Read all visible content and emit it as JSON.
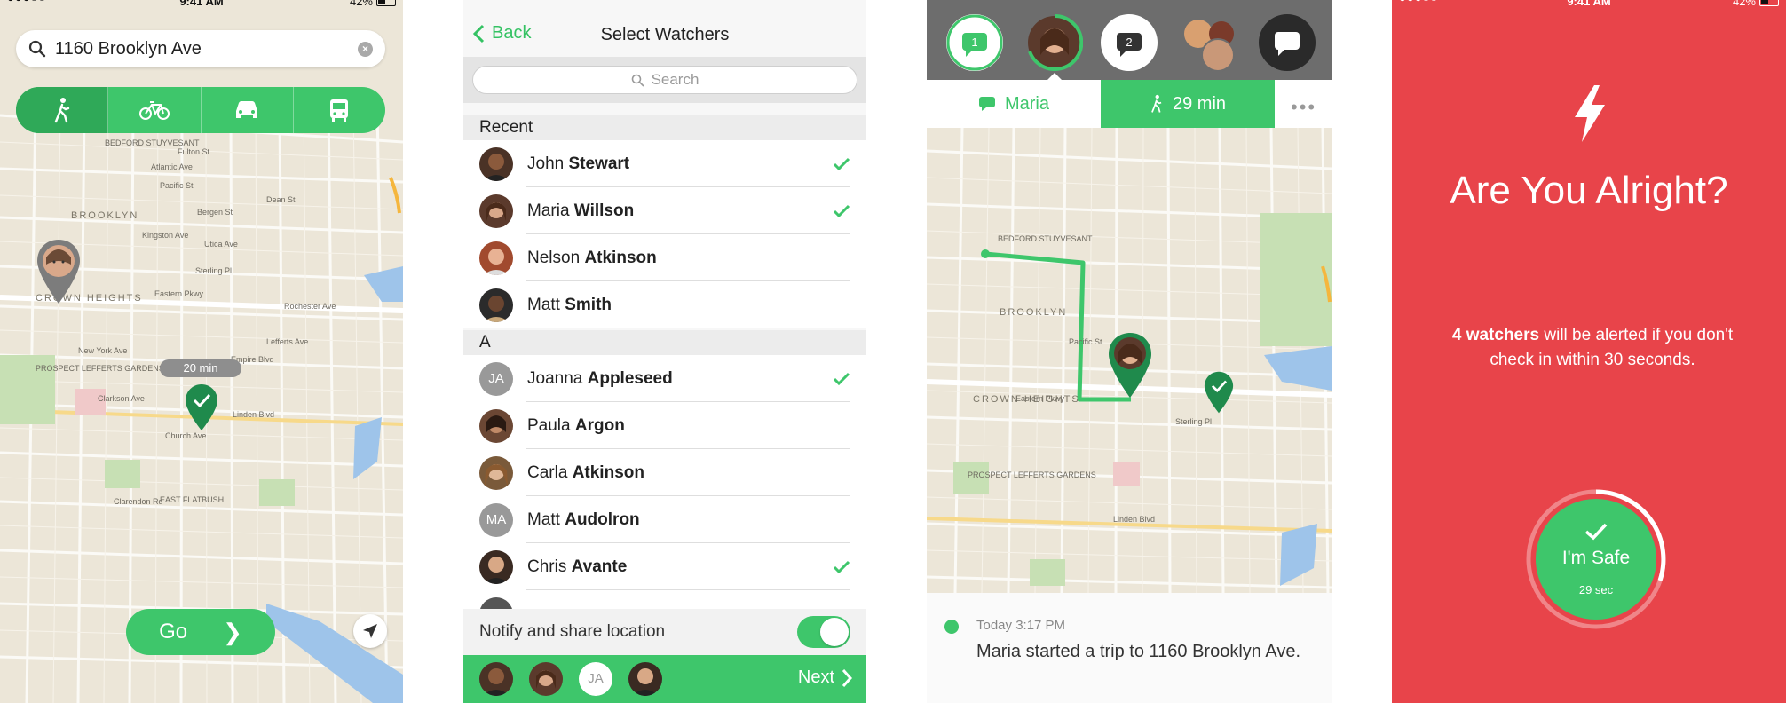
{
  "status": {
    "time": "9:41 AM",
    "battery": "42%"
  },
  "screen1": {
    "search_value": "1160 Brooklyn Ave",
    "modes": [
      "walk-icon",
      "bike-icon",
      "car-icon",
      "bus-icon"
    ],
    "eta": "20 min",
    "go_label": "Go",
    "map_labels": [
      "BROOKLYN",
      "CROWN HEIGHTS",
      "BEDFORD STUYVESANT",
      "PROSPECT LEFFERTS GARDENS",
      "EAST FLATBUSH",
      "Linden Blvd",
      "Church Ave",
      "Clarkson Ave",
      "Eastern Pkwy",
      "Atlantic Ave",
      "Fulton St",
      "Bergen St",
      "Dean St",
      "Pacific St",
      "Sterling Pl",
      "Lefferts Ave",
      "Empire Blvd",
      "Clarendon Rd",
      "New York Ave",
      "Kingston Ave",
      "Utica Ave",
      "Rochester Ave"
    ]
  },
  "screen2": {
    "back_label": "Back",
    "title": "Select Watchers",
    "search_placeholder": "Search",
    "recent_header": "Recent",
    "recent": [
      {
        "first": "John",
        "last": "Stewart",
        "checked": true
      },
      {
        "first": "Maria",
        "last": "Willson",
        "checked": true
      },
      {
        "first": "Nelson",
        "last": "Atkinson",
        "checked": false
      },
      {
        "first": "Matt",
        "last": "Smith",
        "checked": false
      }
    ],
    "a_header": "A",
    "a_list": [
      {
        "first": "Joanna",
        "last": "Appleseed",
        "initials": "JA",
        "checked": true
      },
      {
        "first": "Paula",
        "last": "Argon",
        "initials": "",
        "checked": false
      },
      {
        "first": "Carla",
        "last": "Atkinson",
        "initials": "",
        "checked": false
      },
      {
        "first": "Matt",
        "last": "Audolron",
        "initials": "MA",
        "checked": false
      },
      {
        "first": "Chris",
        "last": "Avante",
        "initials": "",
        "checked": true
      }
    ],
    "notify_label": "Notify and share location",
    "selected_initials": "JA",
    "next_label": "Next"
  },
  "screen3": {
    "badge1": "1",
    "badge2": "2",
    "tab_name": "Maria",
    "tab_eta": "29 min",
    "more": "•••",
    "feed_time": "Today 3:17 PM",
    "feed_msg": "Maria started a trip to 1160 Brooklyn Ave."
  },
  "screen4": {
    "title": "Are You Alright?",
    "msg_bold": "4 watchers",
    "msg_rest": " will be alerted if you don't check in within 30 seconds.",
    "safe_label": "I'm Safe",
    "countdown": "29 sec"
  },
  "colors": {
    "green": "#3ec66b",
    "red": "#e8444a"
  }
}
